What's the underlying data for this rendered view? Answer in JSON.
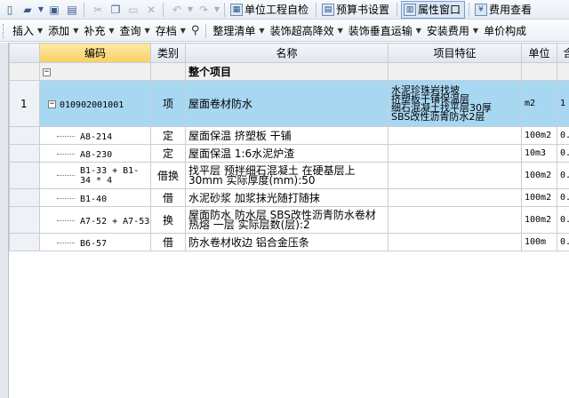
{
  "toolbar1": {
    "btn_self_check": "单位工程自检",
    "btn_budget_settings": "预算书设置",
    "btn_property_window": "属性窗口",
    "btn_fee_query": "费用查看"
  },
  "toolbar2": {
    "insert": "插入",
    "add": "添加",
    "supplement": "补充",
    "query": "查询",
    "store": "存档",
    "organize_list": "整理清单",
    "decor_height_reduction": "装饰超高降效",
    "decor_vertical_transport": "装饰垂直运输",
    "install_fee": "安装费用",
    "unit_price_composition": "单价构成"
  },
  "grid": {
    "headers": {
      "code": "编码",
      "category": "类别",
      "name": "名称",
      "features": "项目特征",
      "unit": "单位",
      "extra": "含"
    },
    "group_row": {
      "expander": "−",
      "name": "整个项目"
    },
    "item_row": {
      "row_number": "1",
      "expander": "−",
      "code": "010902001001",
      "category": "项",
      "name": "屋面卷材防水",
      "features": [
        "水泥珍珠岩找坡",
        "挤塑板干铺保温层",
        "细石混凝土找平层30厚",
        "SBS改性沥青防水2层"
      ],
      "unit": "m2",
      "extra": "1"
    },
    "sub_rows": [
      {
        "code": "A8-214",
        "category": "定",
        "name": "屋面保温 挤塑板 干铺",
        "unit": "100m2",
        "extra": "0."
      },
      {
        "code": "A8-230",
        "category": "定",
        "name": "屋面保温 1:6水泥炉渣",
        "unit": "10m3",
        "extra": "0."
      },
      {
        "code": "B1-33 + B1-34 * 4",
        "category": "借换",
        "name": "找平层 预拌细石混凝土 在硬基层上 30mm 实际厚度(mm):50",
        "unit": "100m2",
        "extra": "0."
      },
      {
        "code": "B1-40",
        "category": "借",
        "name": "水泥砂浆 加浆抹光随打随抹",
        "unit": "100m2",
        "extra": "0."
      },
      {
        "code": "A7-52 + A7-53",
        "category": "换",
        "name": "屋面防水 防水层 SBS改性沥青防水卷材 热熔 一层 实际层数(层):2",
        "unit": "100m2",
        "extra": "0."
      },
      {
        "code": "B6-57",
        "category": "借",
        "name": "防水卷材收边 铝合金压条",
        "unit": "100m",
        "extra": "0."
      }
    ]
  }
}
